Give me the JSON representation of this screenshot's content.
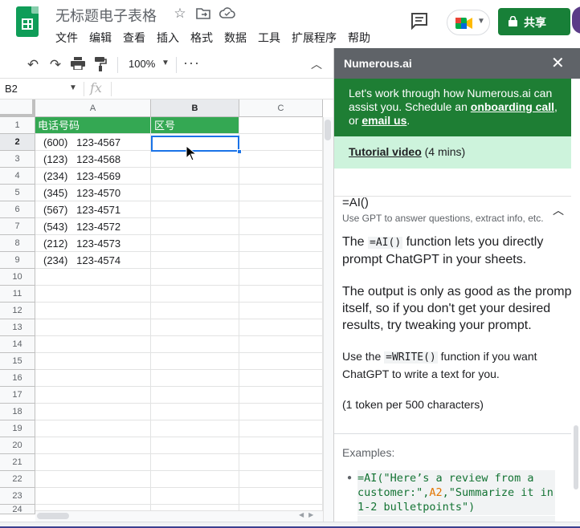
{
  "header": {
    "title": "无标题电子表格",
    "menus": [
      "文件",
      "编辑",
      "查看",
      "插入",
      "格式",
      "数据",
      "工具",
      "扩展程序",
      "帮助"
    ],
    "share_label": "共享"
  },
  "toolbar": {
    "zoom": "100%"
  },
  "formula_bar": {
    "name_box": "B2",
    "fx": "fx"
  },
  "grid": {
    "columns": [
      "A",
      "B",
      "C"
    ],
    "selected_column": "B",
    "selected_row": 2,
    "rows": [
      "1",
      "2",
      "3",
      "4",
      "5",
      "6",
      "7",
      "8",
      "9",
      "10",
      "11",
      "12",
      "13",
      "14",
      "15",
      "16",
      "17",
      "18",
      "19",
      "20",
      "21",
      "22",
      "23",
      "24"
    ],
    "header_cells": {
      "a": "电话号码",
      "b": "区号"
    },
    "phone_numbers": [
      "(600)   123-4567",
      "(123)   123-4568",
      "(234)   123-4569",
      "(345)   123-4570",
      "(567)   123-4571",
      "(543)   123-4572",
      "(212)   123-4573",
      "(234)   123-4574"
    ]
  },
  "panel": {
    "title": "Numerous.ai",
    "intro_text": "Let's work through how Numerous.ai can assist you. Schedule an ",
    "intro_link1": "onboarding call",
    "intro_mid": ", or ",
    "intro_link2": "email us",
    "intro_end": ".",
    "tutorial_link": "Tutorial video",
    "tutorial_duration": " (4 mins)",
    "function_name": "=AI()",
    "function_desc": "Use GPT to answer questions, extract info, etc.",
    "para1_a": "The ",
    "para1_code": "=AI()",
    "para1_b": " function lets you directly prompt ChatGPT in your sheets.",
    "para2": "The output is only as good as the prompt itself, so if you don't get your desired results, try tweaking your prompt.",
    "para3_a": "Use the ",
    "para3_code": "=WRITE()",
    "para3_b": " function if you want ChatGPT to write a text for you.",
    "para4": "(1 token per 500 characters)",
    "examples_label": "Examples:",
    "example1_a": "=AI(\"Here’s a review from a customer:\",",
    "example1_ref": "A2",
    "example1_b": ",\"Summarize it in 1-2 bulletpoints\")"
  },
  "colors": {
    "sheets_green": "#0f9d58",
    "header_green": "#34a853",
    "share_green": "#188038",
    "panel_intro": "#1e7e34",
    "panel_tutorial": "#cdf3dc",
    "selection_blue": "#1a73e8"
  }
}
